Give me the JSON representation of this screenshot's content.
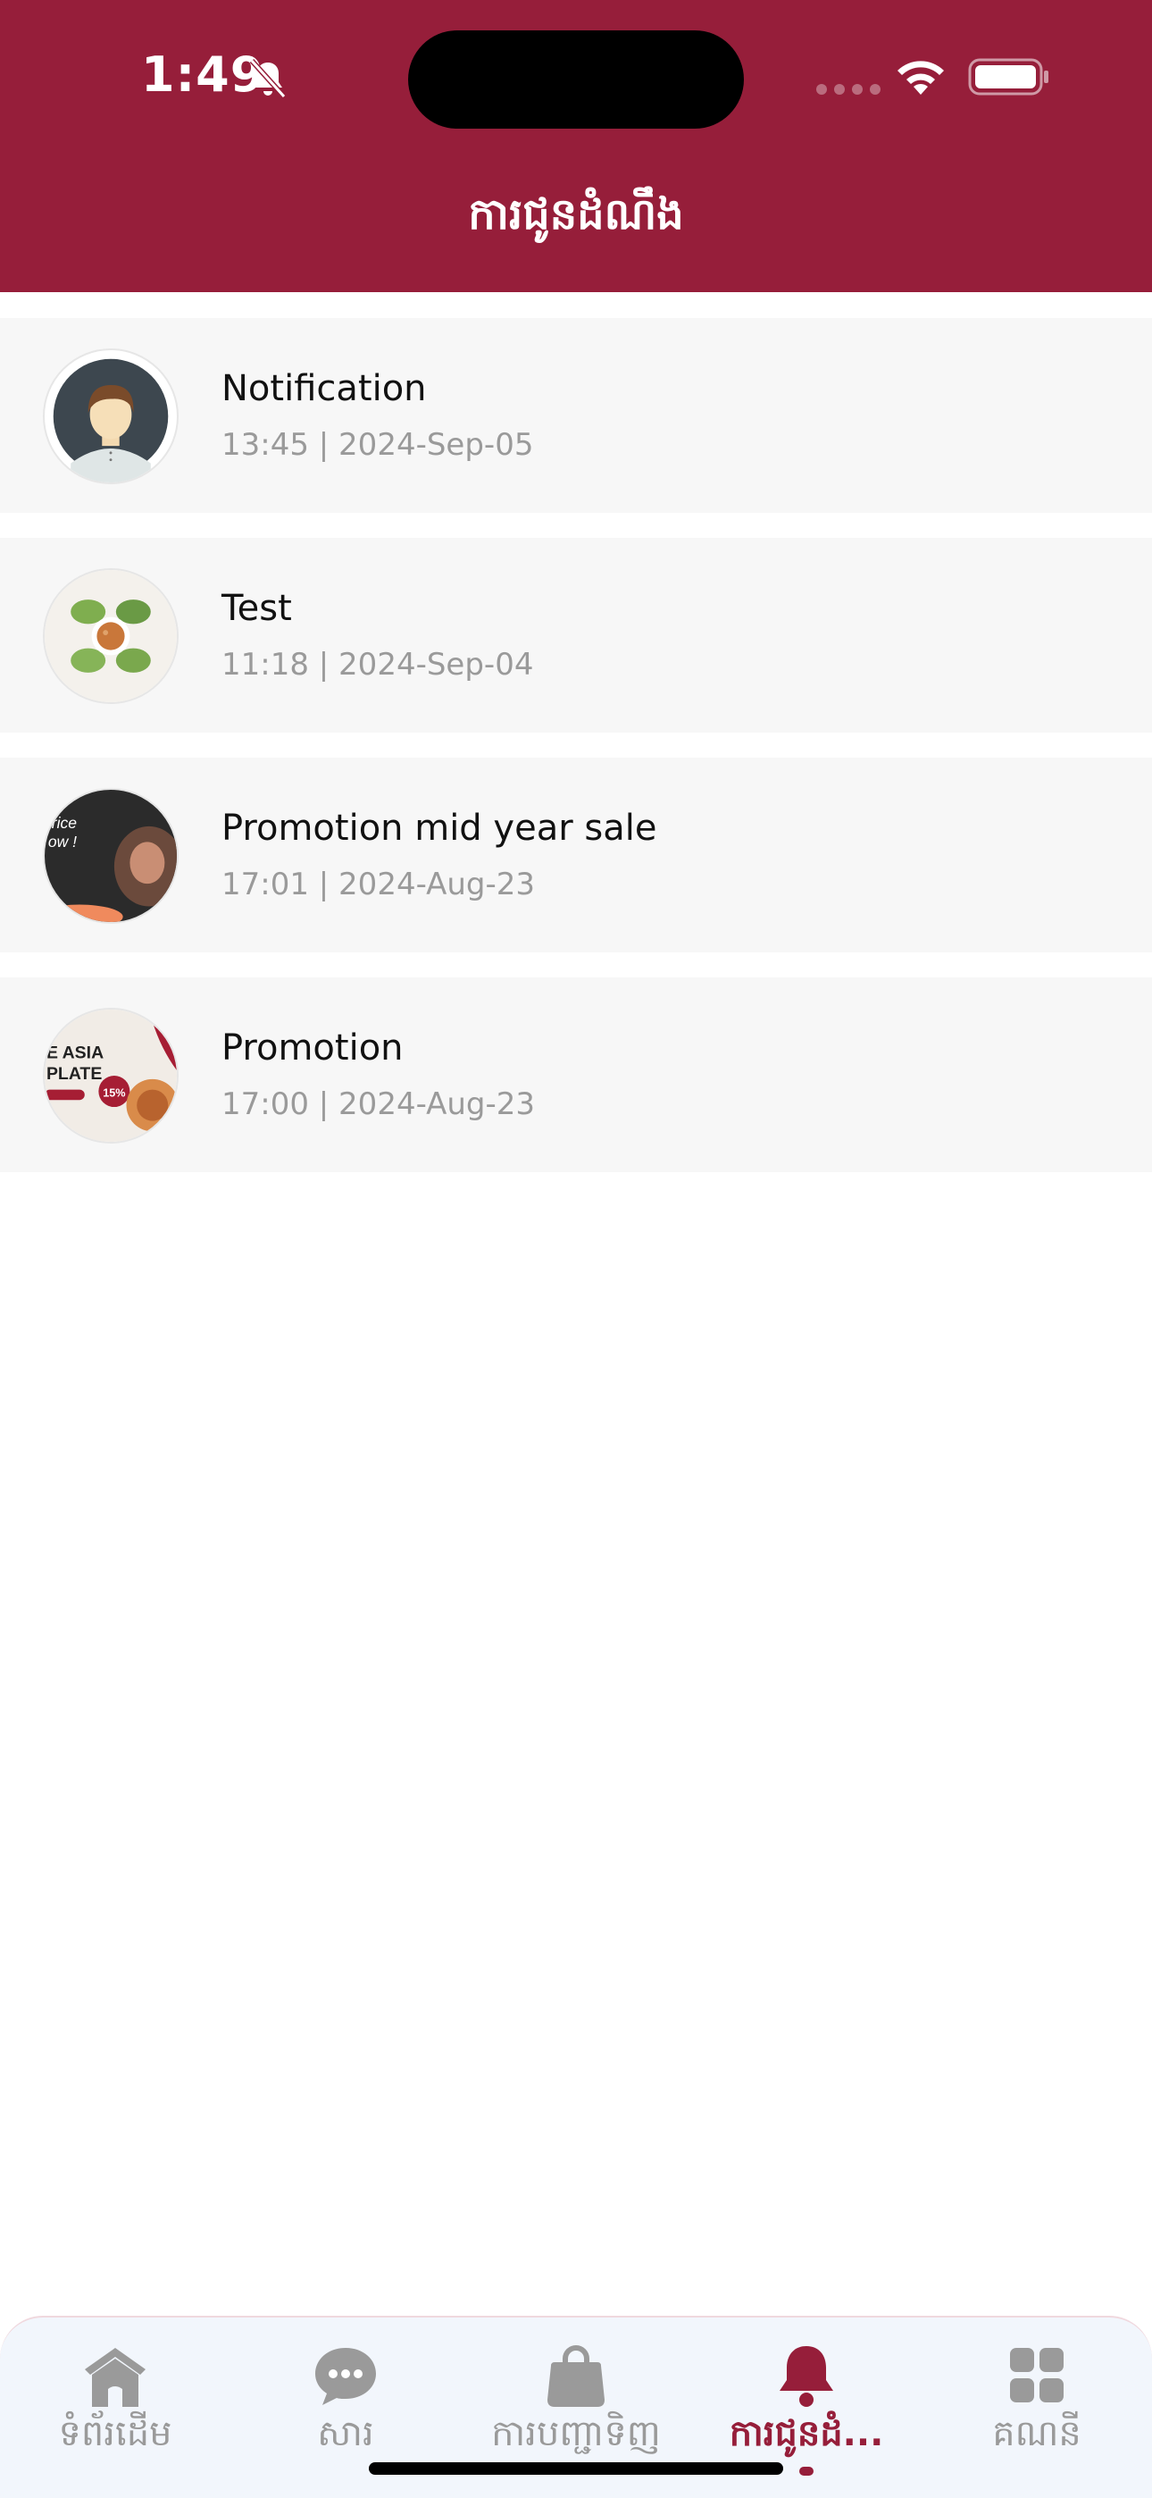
{
  "status_bar": {
    "time": "1:49"
  },
  "header": {
    "title": "ការជូនដំណឹង"
  },
  "notifications": [
    {
      "title": "Notification",
      "meta": "13:45 | 2024-Sep-05",
      "avatar": "person-avatar"
    },
    {
      "title": "Test",
      "meta": "11:18 | 2024-Sep-04",
      "avatar": "food-plate-image"
    },
    {
      "title": "Promotion mid year sale",
      "meta": "17:01 | 2024-Aug-23",
      "avatar": "promo-image"
    },
    {
      "title": "Promotion",
      "meta": "17:00 | 2024-Aug-23",
      "avatar": "promo-plate-image"
    }
  ],
  "promo_thumbnail_text": {
    "promo_mid": [
      "rice",
      "ow !"
    ],
    "promo_plate": [
      "E ASIA",
      "PLATE",
      "15%"
    ]
  },
  "tabbar": {
    "tabs": [
      {
        "label": "ទំព័រដើម",
        "icon": "home-icon"
      },
      {
        "label": "សារ",
        "icon": "chat-icon"
      },
      {
        "label": "ការបញ្ជាទិញ",
        "icon": "bag-icon"
      },
      {
        "label": "ការជូនដំ...",
        "icon": "bell-icon",
        "active": true
      },
      {
        "label": "គណនី",
        "icon": "grid-icon"
      }
    ]
  },
  "colors": {
    "brand": "#961E3A",
    "item_bg": "#F7F7F7",
    "meta_text": "#9a9a9a",
    "tab_inactive": "#9a9a9a"
  }
}
